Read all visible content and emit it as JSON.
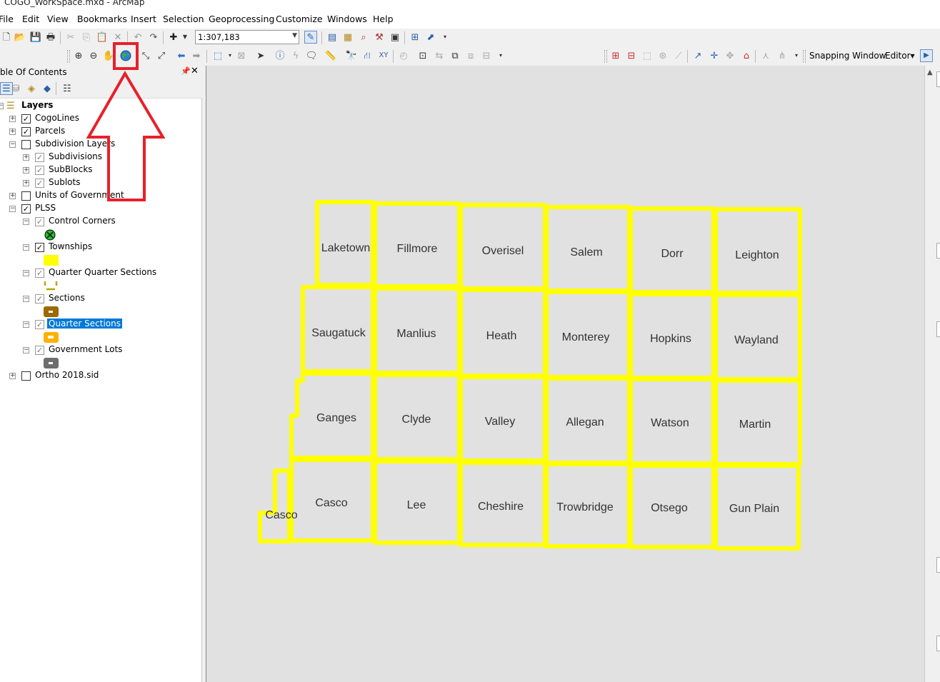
{
  "window": {
    "title": "COGO_WorkSpace.mxd - ArcMap"
  },
  "menu": [
    "File",
    "Edit",
    "View",
    "Bookmarks",
    "Insert",
    "Selection",
    "Geoprocessing",
    "Customize",
    "Windows",
    "Help"
  ],
  "toolbar": {
    "scale": "1:307,183",
    "snapping_window_label": "Snapping Window",
    "editor_label": "Editor▾",
    "highlighted_tool": "full-extent-globe-icon"
  },
  "toc": {
    "title": "ble Of Contents",
    "root": "Layers",
    "layers": [
      {
        "label": "CogoLines",
        "checked": true
      },
      {
        "label": "Parcels",
        "checked": true
      },
      {
        "label": "Subdivision Layers",
        "checked": false
      },
      {
        "label": "Subdivisions",
        "checked": true
      },
      {
        "label": "SubBlocks",
        "checked": true
      },
      {
        "label": "Sublots",
        "checked": true
      },
      {
        "label": "Units of Government",
        "checked": false
      },
      {
        "label": "PLSS",
        "checked": true
      },
      {
        "label": "Control Corners",
        "checked": true
      },
      {
        "label": "Townships",
        "checked": true
      },
      {
        "label": "Quarter Quarter Sections",
        "checked": true
      },
      {
        "label": "Sections",
        "checked": true
      },
      {
        "label": "Quarter Sections",
        "checked": true,
        "selected": true
      },
      {
        "label": "Government Lots",
        "checked": true
      },
      {
        "label": "Ortho 2018.sid",
        "checked": false
      }
    ]
  },
  "map": {
    "townships": [
      [
        "Laketown",
        "Fillmore",
        "Overisel",
        "Salem",
        "Dorr",
        "Leighton"
      ],
      [
        "Saugatuck",
        "Manlius",
        "Heath",
        "Monterey",
        "Hopkins",
        "Wayland"
      ],
      [
        "Ganges",
        "Clyde",
        "Valley",
        "Allegan",
        "Watson",
        "Martin"
      ],
      [
        "Casco",
        "Lee",
        "Cheshire",
        "Trowbridge",
        "Otsego",
        "Gun Plain"
      ]
    ],
    "extra_label": "Casco",
    "outline_color": "#ffff00"
  },
  "colors": {
    "annotation": "#e8202a",
    "selection": "#0078d7",
    "map_bg": "#e1e1e1"
  }
}
